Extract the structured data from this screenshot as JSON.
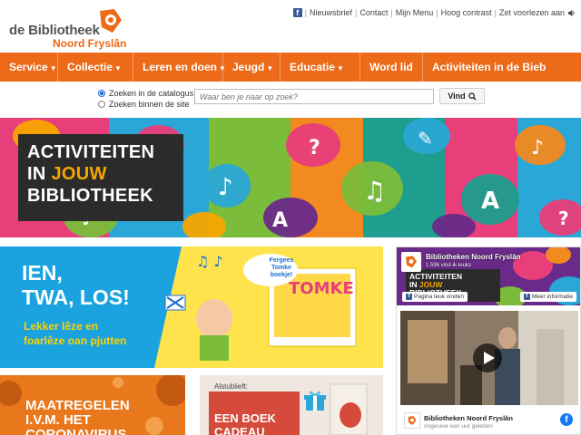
{
  "brand": {
    "line1": "de Bibliotheek",
    "line2": "Noord Fryslân",
    "accent": "#ec6a18"
  },
  "toplinks": [
    "Nieuwsbrief",
    "Contact",
    "Mijn Menu",
    "Hoog contrast",
    "Zet voorlezen aan"
  ],
  "nav": [
    {
      "label": "Service",
      "caret": true
    },
    {
      "label": "Collectie",
      "caret": true
    },
    {
      "label": "Leren en doen",
      "caret": true
    },
    {
      "label": "Jeugd",
      "caret": true
    },
    {
      "label": "Educatie",
      "caret": true
    },
    {
      "label": "Word lid",
      "caret": false
    },
    {
      "label": "Activiteiten in de Bieb",
      "caret": false
    }
  ],
  "search": {
    "option_catalog": "Zoeken in de catalogus",
    "option_site": "Zoeken binnen de site",
    "placeholder": "Waar ben je naar op zoek?",
    "button": "Vind"
  },
  "hero": {
    "line1": "ACTIVITEITEN",
    "line2a": "IN ",
    "line2b": "JOUW",
    "line3": "BIBLIOTHEEK"
  },
  "promo": {
    "title1": "IEN,",
    "title2": "TWA, LOS!",
    "sub1": "Lekker lêze en",
    "sub2": "foarlêze oan pjutten",
    "bubble": "Fergees Tomke boekje!",
    "book_title": "TOMKE"
  },
  "facebook": {
    "page_name": "Bibliotheken Noord Fryslân",
    "followers": "1.596 vind-ik-leuks",
    "like_label": "Pagina leuk vinden",
    "more_label": "Meer informatie",
    "post_name": "Bibliotheken Noord Fryslân",
    "post_meta": "ongeveer een uur geleden",
    "cover_title1": "ACTIVITEITEN",
    "cover_title2a": "IN ",
    "cover_title2b": "JOUW",
    "cover_title3": "BIBLIOTHEEK"
  },
  "tiles": {
    "corona1": "MAATREGELEN",
    "corona2": "I.V.M. HET",
    "corona3": "CORONAVIRUS",
    "gift_kicker": "Alstublieft:",
    "gift1": "EEN BOEK",
    "gift2": "CADEAU"
  }
}
